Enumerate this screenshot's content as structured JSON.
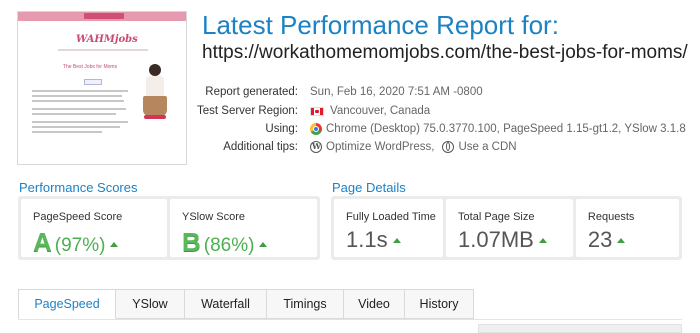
{
  "header": {
    "title": "Latest Performance Report for:",
    "url": "https://workathomemomjobs.com/the-best-jobs-for-moms/"
  },
  "thumbnail": {
    "brand": "WAHMjobs",
    "post_title": "The Best Jobs for Moms"
  },
  "meta": [
    {
      "label": "Report generated:",
      "value": "Sun, Feb 16, 2020 7:51 AM -0800"
    },
    {
      "label": "Test Server Region:",
      "value": "Vancouver, Canada",
      "icon": "canada-flag-icon"
    },
    {
      "label": "Using:",
      "value": "Chrome (Desktop) 75.0.3770.100, PageSpeed 1.15-gt1.2, YSlow 3.1.8",
      "icon": "chrome-icon"
    },
    {
      "label": "Additional tips:",
      "tips": [
        "Optimize WordPress,",
        "Use a CDN"
      ],
      "icons": [
        "wordpress-icon",
        "globe-icon"
      ]
    }
  ],
  "performance_scores": {
    "title": "Performance Scores",
    "items": [
      {
        "label": "PageSpeed Score",
        "grade": "A",
        "value": "(97%)"
      },
      {
        "label": "YSlow Score",
        "grade": "B",
        "value": "(86%)"
      }
    ]
  },
  "page_details": {
    "title": "Page Details",
    "items": [
      {
        "label": "Fully Loaded Time",
        "value": "1.1s"
      },
      {
        "label": "Total Page Size",
        "value": "1.07MB"
      },
      {
        "label": "Requests",
        "value": "23"
      }
    ]
  },
  "tabs": [
    {
      "label": "PageSpeed",
      "active": true
    },
    {
      "label": "YSlow",
      "active": false
    },
    {
      "label": "Waterfall",
      "active": false
    },
    {
      "label": "Timings",
      "active": false
    },
    {
      "label": "Video",
      "active": false
    },
    {
      "label": "History",
      "active": false
    }
  ],
  "colors": {
    "accent": "#1c82c4",
    "grade_green": "#5bb75b",
    "pink_brand": "#c94b70"
  }
}
